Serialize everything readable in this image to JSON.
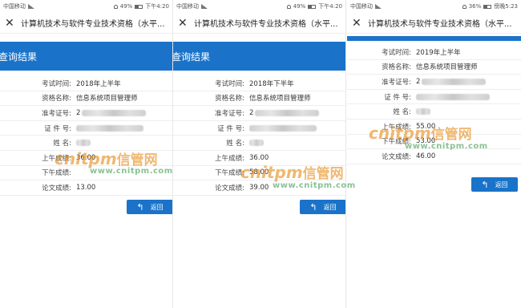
{
  "status_bars": [
    {
      "carrier": "中国移动",
      "battery": "49%",
      "time": "下午4:20"
    },
    {
      "carrier": "中国移动",
      "battery": "49%",
      "time": "下午4:20"
    },
    {
      "carrier": "中国移动",
      "battery": "36%",
      "time": "傍晚5:23"
    }
  ],
  "title": "计算机技术与软件专业技术资格（水平...",
  "header": "查询结果",
  "labels": {
    "exam_time": "考试时间:",
    "qualification": "资格名称:",
    "ticket_no": "准考证号:",
    "id_no": "证 件 号:",
    "name": "姓   名:",
    "am_score": "上午成绩:",
    "pm_score": "下午成绩:",
    "essay_score": "论文成绩:"
  },
  "results": [
    {
      "exam_time": "2018年上半年",
      "qualification": "信息系统项目管理师",
      "ticket_no": "2",
      "am_score": "36.00",
      "pm_score": "",
      "essay_score": "13.00"
    },
    {
      "exam_time": "2018年下半年",
      "qualification": "信息系统项目管理师",
      "ticket_no": "2",
      "am_score": "36.00",
      "pm_score": "58.00",
      "essay_score": "39.00"
    },
    {
      "exam_time": "2019年上半年",
      "qualification": "信息系统项目管理师",
      "ticket_no": "2",
      "am_score": "55.00",
      "pm_score": "53.00",
      "essay_score": "46.00"
    }
  ],
  "back_button": "返回",
  "watermark": {
    "brand": "cnitpm",
    "brand_cn": "信管网",
    "url": "www.cnitpm.com"
  },
  "colors": {
    "accent": "#1a73c9",
    "watermark_orange": "#e58a16",
    "watermark_green": "#2a8f3c"
  }
}
